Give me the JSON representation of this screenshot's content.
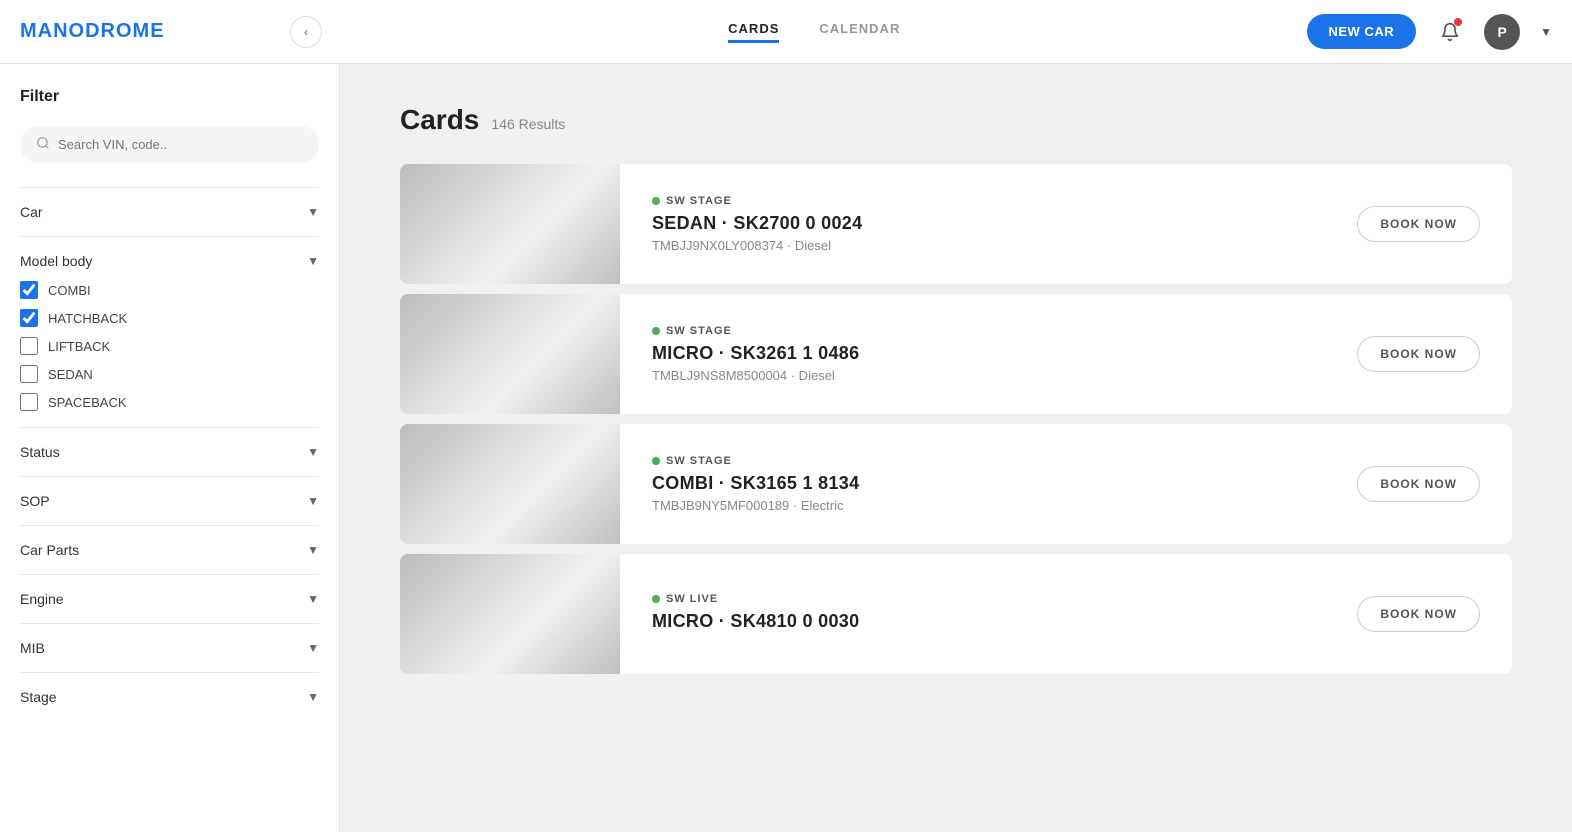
{
  "header": {
    "logo": "MANODROME",
    "nav_tabs": [
      {
        "id": "cards",
        "label": "CARDS",
        "active": true
      },
      {
        "id": "calendar",
        "label": "CALENDAR",
        "active": false
      }
    ],
    "new_car_button": "NEW CAR",
    "avatar_letter": "P"
  },
  "sidebar": {
    "filter_title": "Filter",
    "search_placeholder": "Search VIN, code..",
    "sections": [
      {
        "id": "car",
        "label": "Car",
        "expanded": false,
        "items": []
      },
      {
        "id": "model_body",
        "label": "Model body",
        "expanded": true,
        "items": [
          {
            "id": "combi",
            "label": "COMBI",
            "checked": true
          },
          {
            "id": "hatchback",
            "label": "HATCHBACK",
            "checked": true
          },
          {
            "id": "liftback",
            "label": "LIFTBACK",
            "checked": false
          },
          {
            "id": "sedan",
            "label": "SEDAN",
            "checked": false
          },
          {
            "id": "spaceback",
            "label": "SPACEBACK",
            "checked": false
          }
        ]
      },
      {
        "id": "status",
        "label": "Status",
        "expanded": false,
        "items": []
      },
      {
        "id": "sop",
        "label": "SOP",
        "expanded": false,
        "items": []
      },
      {
        "id": "car_parts",
        "label": "Car Parts",
        "expanded": false,
        "items": []
      },
      {
        "id": "engine",
        "label": "Engine",
        "expanded": false,
        "items": []
      },
      {
        "id": "mib",
        "label": "MIB",
        "expanded": false,
        "items": []
      },
      {
        "id": "stage",
        "label": "Stage",
        "expanded": false,
        "items": []
      }
    ]
  },
  "content": {
    "page_title": "Cards",
    "results_count": "146 Results",
    "cars": [
      {
        "id": "car1",
        "stage_label": "SW STAGE",
        "stage_color": "green",
        "name": "SEDAN · SK2700 0 0024",
        "vin": "TMBJJ9NX0LY008374 · Diesel",
        "book_button": "BOOK NOW",
        "car_type": "sedan"
      },
      {
        "id": "car2",
        "stage_label": "SW STAGE",
        "stage_color": "green",
        "name": "MICRO · SK3261 1 0486",
        "vin": "TMBLJ9NS8M8500004 · Diesel",
        "book_button": "BOOK NOW",
        "car_type": "micro"
      },
      {
        "id": "car3",
        "stage_label": "SW STAGE",
        "stage_color": "green",
        "name": "COMBI · SK3165 1 8134",
        "vin": "TMBJB9NY5MF000189 · Electric",
        "book_button": "BOOK NOW",
        "car_type": "combi"
      },
      {
        "id": "car4",
        "stage_label": "SW LIVE",
        "stage_color": "green",
        "name": "MICRO · SK4810 0 0030",
        "vin": "",
        "book_button": "BOOK NOW",
        "car_type": "micro2"
      }
    ]
  }
}
